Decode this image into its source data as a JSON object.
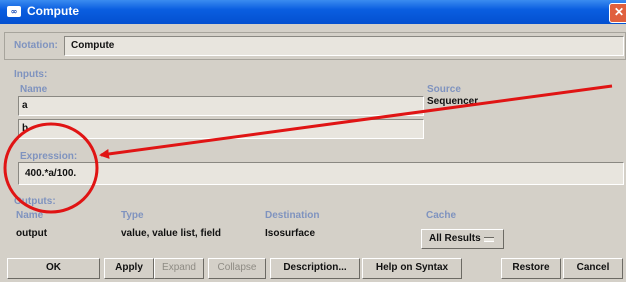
{
  "window": {
    "title": "Compute",
    "icon": "app-icon"
  },
  "notation": {
    "label": "Notation:",
    "value": "Compute"
  },
  "inputs": {
    "label": "Inputs:",
    "name_header": "Name",
    "source_header": "Source",
    "rows": [
      {
        "name": "a",
        "source": "Sequencer"
      },
      {
        "name": "b",
        "source": ""
      }
    ]
  },
  "expression": {
    "label": "Expression:",
    "value": "400.*a/100."
  },
  "outputs": {
    "label": "Outputs:",
    "headers": {
      "name": "Name",
      "type": "Type",
      "destination": "Destination",
      "cache": "Cache"
    },
    "row": {
      "name": "output",
      "type": "value, value list, field",
      "destination": "Isosurface",
      "cache": "All Results"
    }
  },
  "buttons": {
    "ok": "OK",
    "apply": "Apply",
    "expand": "Expand",
    "collapse": "Collapse",
    "description": "Description...",
    "help": "Help on Syntax",
    "restore": "Restore",
    "cancel": "Cancel"
  },
  "colors": {
    "title_blue": "#0a5ee0",
    "annotation_red": "#e01414",
    "label_blue": "#7f93bf"
  }
}
